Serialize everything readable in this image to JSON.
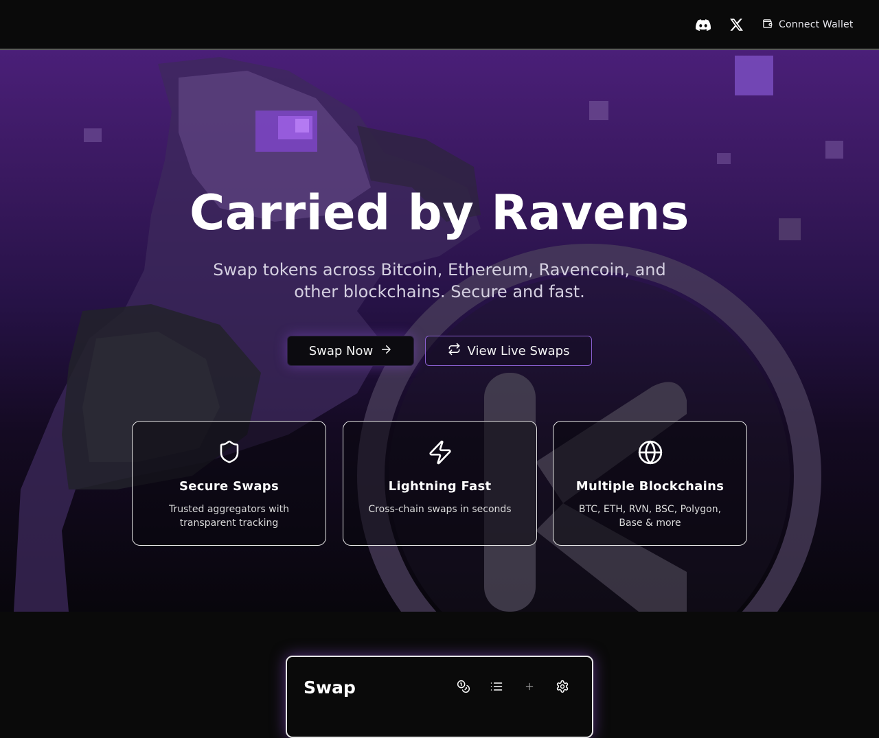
{
  "header": {
    "discord_icon": "discord-icon",
    "x_icon": "x-logo-icon",
    "connect_wallet_label": "Connect Wallet",
    "wallet_icon": "wallet-icon"
  },
  "hero": {
    "title": "Carried by Ravens",
    "subtitle": "Swap tokens across Bitcoin, Ethereum, Ravencoin, and other blockchains. Secure and fast.",
    "swap_now_label": "Swap Now",
    "view_live_label": "View Live Swaps",
    "accent_color": "#8a5fd0",
    "features": [
      {
        "icon": "shield-icon",
        "title": "Secure Swaps",
        "desc": "Trusted aggregators with transparent tracking"
      },
      {
        "icon": "lightning-icon",
        "title": "Lightning Fast",
        "desc": "Cross-chain swaps in seconds"
      },
      {
        "icon": "globe-icon",
        "title": "Multiple Blockchains",
        "desc": "BTC, ETH, RVN, BSC, Polygon, Base & more"
      }
    ]
  },
  "swap_panel": {
    "title": "Swap",
    "tools": [
      "coins-icon",
      "list-icon",
      "plus-icon",
      "gear-icon"
    ]
  }
}
